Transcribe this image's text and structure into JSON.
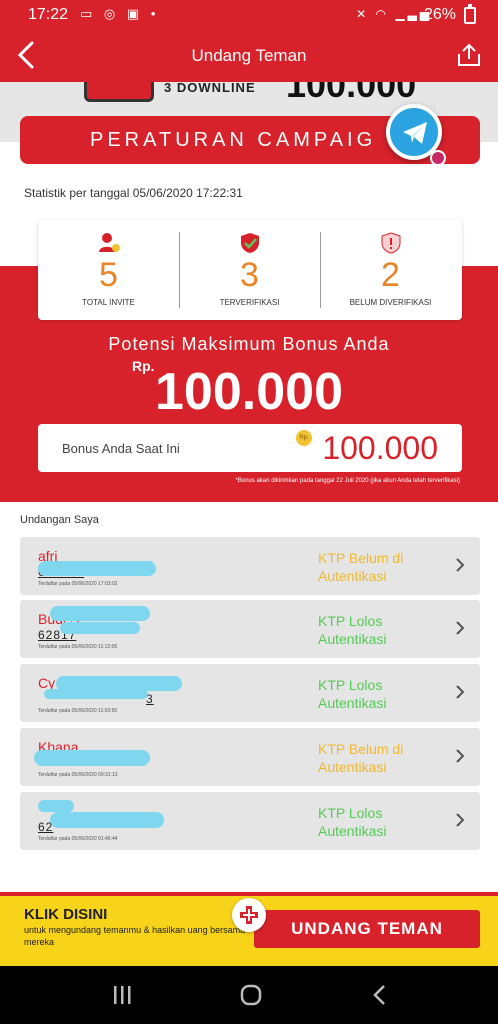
{
  "status_bar": {
    "time": "17:22",
    "battery": "26%",
    "left_icons": [
      "monitor-icon",
      "instagram-icon",
      "app-icon",
      "dot-icon"
    ],
    "right_icons": [
      "mute-icon",
      "wifi-icon",
      "signal-icon"
    ]
  },
  "app_bar": {
    "title": "Undang Teman"
  },
  "banner": {
    "downline_text": "3 DOWNLINE",
    "amount": "100.000"
  },
  "rules_button": {
    "label": "PERATURAN CAMPAIG"
  },
  "stats": {
    "date_label": "Statistik per tanggal 05/06/2020 17:22:31",
    "items": [
      {
        "value": "5",
        "label": "TOTAL INVITE",
        "icon": "user-add-icon"
      },
      {
        "value": "3",
        "label": "TERVERIFIKASI",
        "icon": "shield-check-icon"
      },
      {
        "value": "2",
        "label": "BELUM DIVERIFIKASI",
        "icon": "shield-alert-icon"
      }
    ]
  },
  "bonus": {
    "potensi_label": "Potensi Maksimum Bonus Anda",
    "currency": "Rp.",
    "max_amount": "100.000",
    "current_label": "Bonus Anda Saat Ini",
    "current_amount": "100.000",
    "coin_label": "Rp.",
    "disclaimer": "*Bonus akan dikirimkan pada tanggal 22 Juli 2020 (jika akun Anda telah terverifikasi)"
  },
  "invitations": {
    "title": "Undangan Saya",
    "items": [
      {
        "name": "afri",
        "phone": "628138",
        "registered": "Terdaftar pada 05/06/2020 17:03:02",
        "status": "KTP Belum di Autentikasi",
        "status_type": "belum"
      },
      {
        "name": "Budi S",
        "phone": "62817",
        "registered": "Terdaftar pada 05/06/2020 11:12:06",
        "status": "KTP Lolos Autentikasi",
        "status_type": "lolos"
      },
      {
        "name": "Cy",
        "phone": "3",
        "registered": "Terdaftar pada 05/06/2020 11:03:50",
        "status": "KTP Lolos Autentikasi",
        "status_type": "lolos"
      },
      {
        "name": "Khana",
        "phone": "",
        "registered": "Terdaftar pada 05/06/2020 09:31:13",
        "status": "KTP Belum di Autentikasi",
        "status_type": "belum"
      },
      {
        "name": "",
        "phone": "62",
        "registered": "Terdaftar pada 05/06/2020 01:46:44",
        "status": "KTP Lolos Autentikasi",
        "status_type": "lolos"
      }
    ]
  },
  "cta": {
    "title": "KLIK DISINI",
    "description": "untuk mengundang temanmu & hasilkan uang bersama mereka",
    "button_label": "UNDANG TEMAN"
  },
  "colors": {
    "primary": "#d8222b",
    "accent_yellow": "#f7d31a",
    "number_orange": "#e8852a",
    "status_pending": "#f0b830",
    "status_ok": "#55c955"
  }
}
